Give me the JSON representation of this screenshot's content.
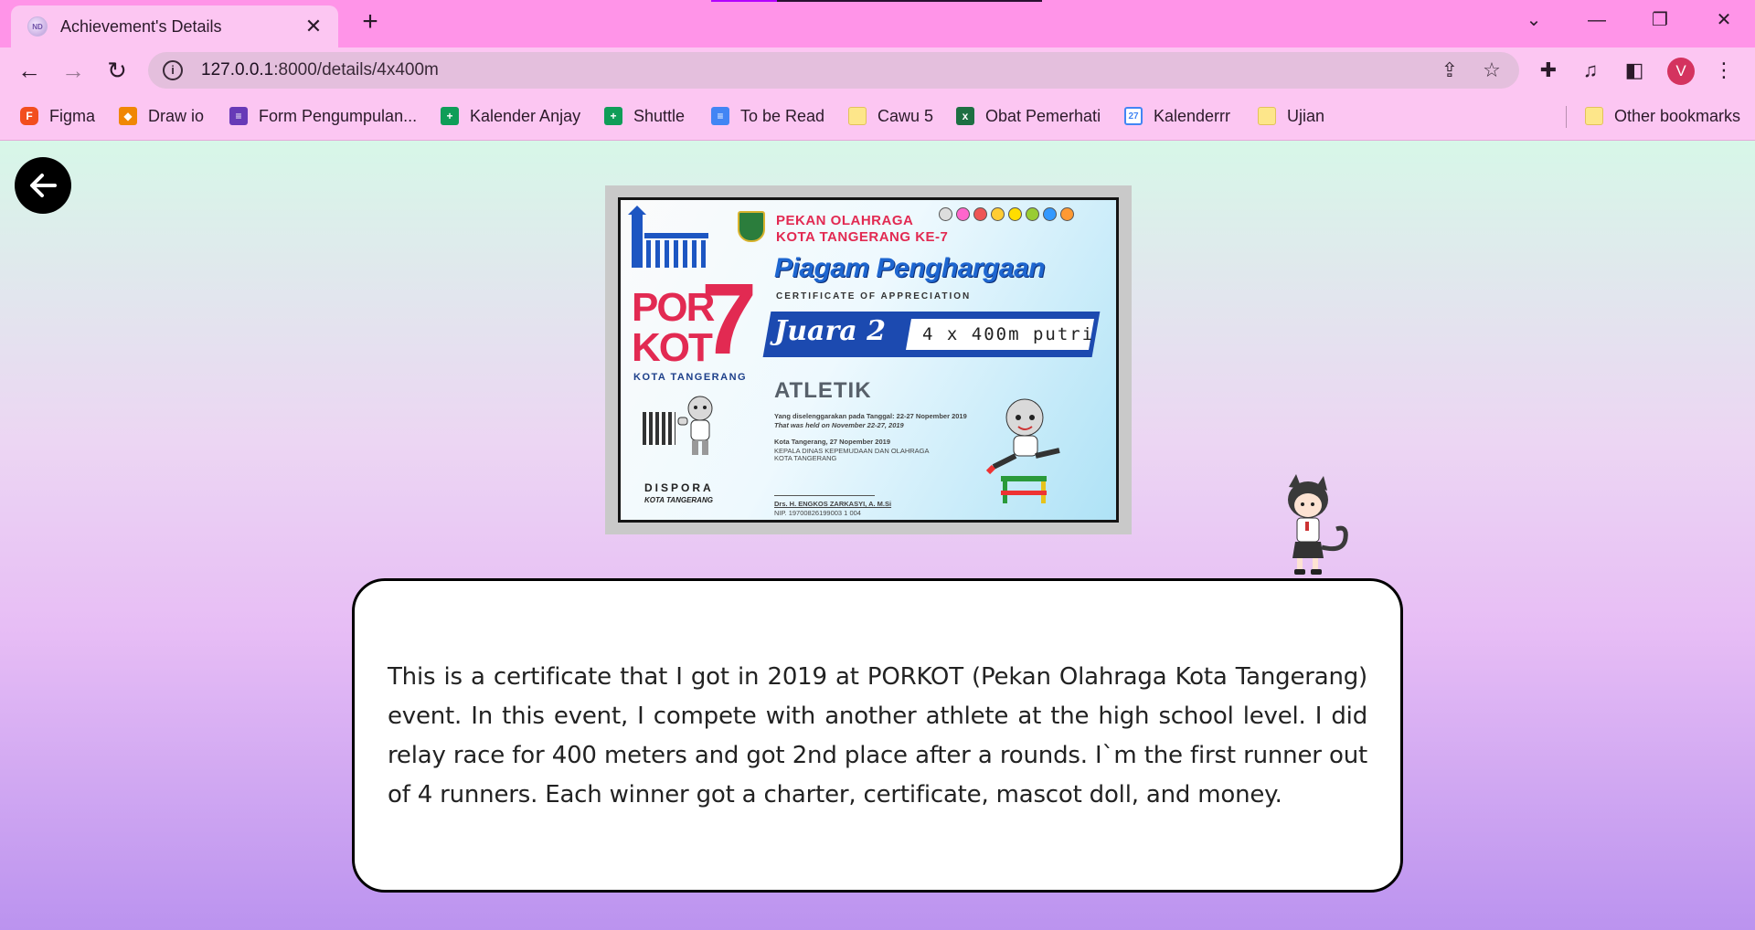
{
  "browser": {
    "tab_title": "Achievement's Details",
    "favicon": "site-favicon",
    "url_host": "127.0.0.1",
    "url_path": ":8000/details/4x400m",
    "avatar_letter": "V",
    "colors": {
      "frame": "#ff94e8",
      "toolbar": "#fcc6f2",
      "omnibox": "#e4bfdd",
      "avatar": "#d4335f"
    }
  },
  "bookmarks": [
    {
      "label": "Figma",
      "icon": "figma-icon"
    },
    {
      "label": "Draw io",
      "icon": "drawio-icon"
    },
    {
      "label": "Form Pengumpulan...",
      "icon": "google-forms-icon"
    },
    {
      "label": "Kalender Anjay",
      "icon": "google-sheets-icon"
    },
    {
      "label": "Shuttle",
      "icon": "google-sheets-icon"
    },
    {
      "label": "To be Read",
      "icon": "google-docs-icon"
    },
    {
      "label": "Cawu 5",
      "icon": "folder-icon"
    },
    {
      "label": "Obat Pemerhati",
      "icon": "excel-icon"
    },
    {
      "label": "Kalenderrr",
      "icon": "google-calendar-icon"
    },
    {
      "label": "Ujian",
      "icon": "folder-icon"
    }
  ],
  "other_bookmarks": "Other bookmarks",
  "certificate": {
    "header_line1": "PEKAN OLAHRAGA",
    "header_line2": "KOTA TANGERANG KE-7",
    "title": "Piagam Penghargaan",
    "subtitle": "CERTIFICATE OF APPRECIATION",
    "rank": "Juara 2",
    "event": "4 x 400m putri",
    "sport": "ATLETIK",
    "logo_top": "POR",
    "logo_bottom": "KOT",
    "logo_number": "7",
    "logo_city": "KOTA TANGERANG",
    "held_line1": "Yang diselenggarakan pada Tanggal: 22-27 Nopember 2019",
    "held_line2": "That was held on November 22-27, 2019",
    "place_date": "Kota Tangerang, 27 Nopember 2019",
    "office": "KEPALA DINAS KEPEMUDAAN DAN OLAHRAGA",
    "office2": "KOTA TANGERANG",
    "signer": "Drs. H. ENGKOS ZARKASYI, A. M.Si",
    "nip": "NIP. 19700826199003 1 004",
    "dispora": "DISPORA",
    "dispora_city": "KOTA TANGERANG"
  },
  "description": "This is a certificate that I got in 2019 at PORKOT (Pekan Olahraga Kota Tangerang) event. In this event, I compete with another athlete at the high school level. I did relay race for 400 meters and got 2nd place after a rounds. I`m the first runner out of 4 runners. Each winner got a charter, certificate, mascot doll, and money."
}
